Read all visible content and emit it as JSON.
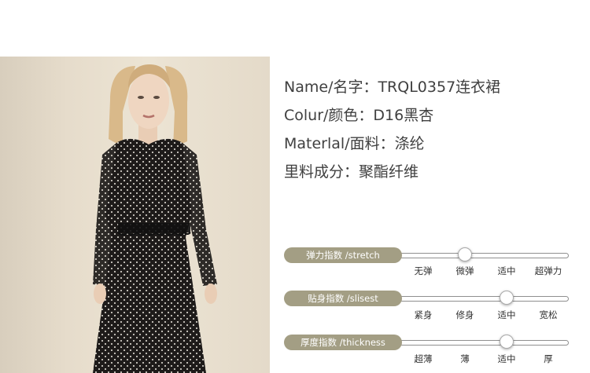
{
  "product": {
    "name_line": "Name/名字：TRQL0357连衣裙",
    "color_line": "Colur/颜色：D16黑杏",
    "material_line": "Materlal/面料：涤纶",
    "lining_line": "里料成分：聚酯纤维"
  },
  "photo": {
    "icon": "model-photo",
    "dress_color": "#1e1b1a",
    "dot_color": "#f2ede4"
  },
  "accent": "#a39e84",
  "sliders": [
    {
      "label": "弹力指数 /stretch",
      "options": [
        "无弹",
        "微弹",
        "适中",
        "超弹力"
      ],
      "selected": "微弹"
    },
    {
      "label": "贴身指数 /slisest",
      "options": [
        "紧身",
        "修身",
        "适中",
        "宽松"
      ],
      "selected": "适中"
    },
    {
      "label": "厚度指数 /thickness",
      "options": [
        "超薄",
        "薄",
        "适中",
        "厚"
      ],
      "selected": "适中"
    }
  ]
}
